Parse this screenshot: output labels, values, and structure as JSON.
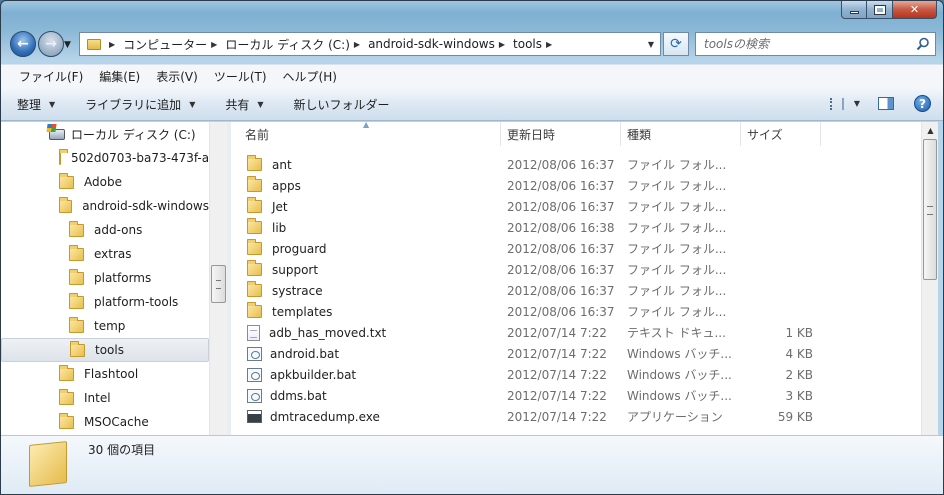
{
  "window": {
    "caption_buttons": [
      "minimize",
      "maximize",
      "close"
    ]
  },
  "address": {
    "crumbs": [
      "コンピューター",
      "ローカル ディスク (C:)",
      "android-sdk-windows",
      "tools"
    ]
  },
  "search": {
    "placeholder": "toolsの検索"
  },
  "menubar": [
    "ファイル(F)",
    "編集(E)",
    "表示(V)",
    "ツール(T)",
    "ヘルプ(H)"
  ],
  "toolbar": {
    "organize": "整理",
    "library": "ライブラリに追加",
    "share": "共有",
    "new_folder": "新しいフォルダー"
  },
  "tree": {
    "drive": "ローカル ディスク (C:)",
    "items": [
      {
        "label": "502d0703-ba73-473f-a",
        "level": 1
      },
      {
        "label": "Adobe",
        "level": 1
      },
      {
        "label": "android-sdk-windows",
        "level": 1
      },
      {
        "label": "add-ons",
        "level": 2
      },
      {
        "label": "extras",
        "level": 2
      },
      {
        "label": "platforms",
        "level": 2
      },
      {
        "label": "platform-tools",
        "level": 2
      },
      {
        "label": "temp",
        "level": 2
      },
      {
        "label": "tools",
        "level": 2,
        "selected": true
      },
      {
        "label": "Flashtool",
        "level": 1
      },
      {
        "label": "Intel",
        "level": 1
      },
      {
        "label": "MSOCache",
        "level": 1
      }
    ]
  },
  "columns": {
    "name": "名前",
    "date": "更新日時",
    "type": "種類",
    "size": "サイズ"
  },
  "files": [
    {
      "name": "ant",
      "date": "2012/08/06 16:37",
      "type": "ファイル フォル...",
      "size": "",
      "icon": "folder"
    },
    {
      "name": "apps",
      "date": "2012/08/06 16:37",
      "type": "ファイル フォル...",
      "size": "",
      "icon": "folder"
    },
    {
      "name": "Jet",
      "date": "2012/08/06 16:37",
      "type": "ファイル フォル...",
      "size": "",
      "icon": "folder"
    },
    {
      "name": "lib",
      "date": "2012/08/06 16:38",
      "type": "ファイル フォル...",
      "size": "",
      "icon": "folder"
    },
    {
      "name": "proguard",
      "date": "2012/08/06 16:37",
      "type": "ファイル フォル...",
      "size": "",
      "icon": "folder"
    },
    {
      "name": "support",
      "date": "2012/08/06 16:37",
      "type": "ファイル フォル...",
      "size": "",
      "icon": "folder"
    },
    {
      "name": "systrace",
      "date": "2012/08/06 16:37",
      "type": "ファイル フォル...",
      "size": "",
      "icon": "folder"
    },
    {
      "name": "templates",
      "date": "2012/08/06 16:37",
      "type": "ファイル フォル...",
      "size": "",
      "icon": "folder"
    },
    {
      "name": "adb_has_moved.txt",
      "date": "2012/07/14 7:22",
      "type": "テキスト ドキュ...",
      "size": "1 KB",
      "icon": "text"
    },
    {
      "name": "android.bat",
      "date": "2012/07/14 7:22",
      "type": "Windows バッチ...",
      "size": "4 KB",
      "icon": "batch"
    },
    {
      "name": "apkbuilder.bat",
      "date": "2012/07/14 7:22",
      "type": "Windows バッチ...",
      "size": "2 KB",
      "icon": "batch"
    },
    {
      "name": "ddms.bat",
      "date": "2012/07/14 7:22",
      "type": "Windows バッチ...",
      "size": "3 KB",
      "icon": "batch"
    },
    {
      "name": "dmtracedump.exe",
      "date": "2012/07/14 7:22",
      "type": "アプリケーション",
      "size": "59 KB",
      "icon": "exe"
    }
  ],
  "details": {
    "count": "30 個の項目"
  }
}
